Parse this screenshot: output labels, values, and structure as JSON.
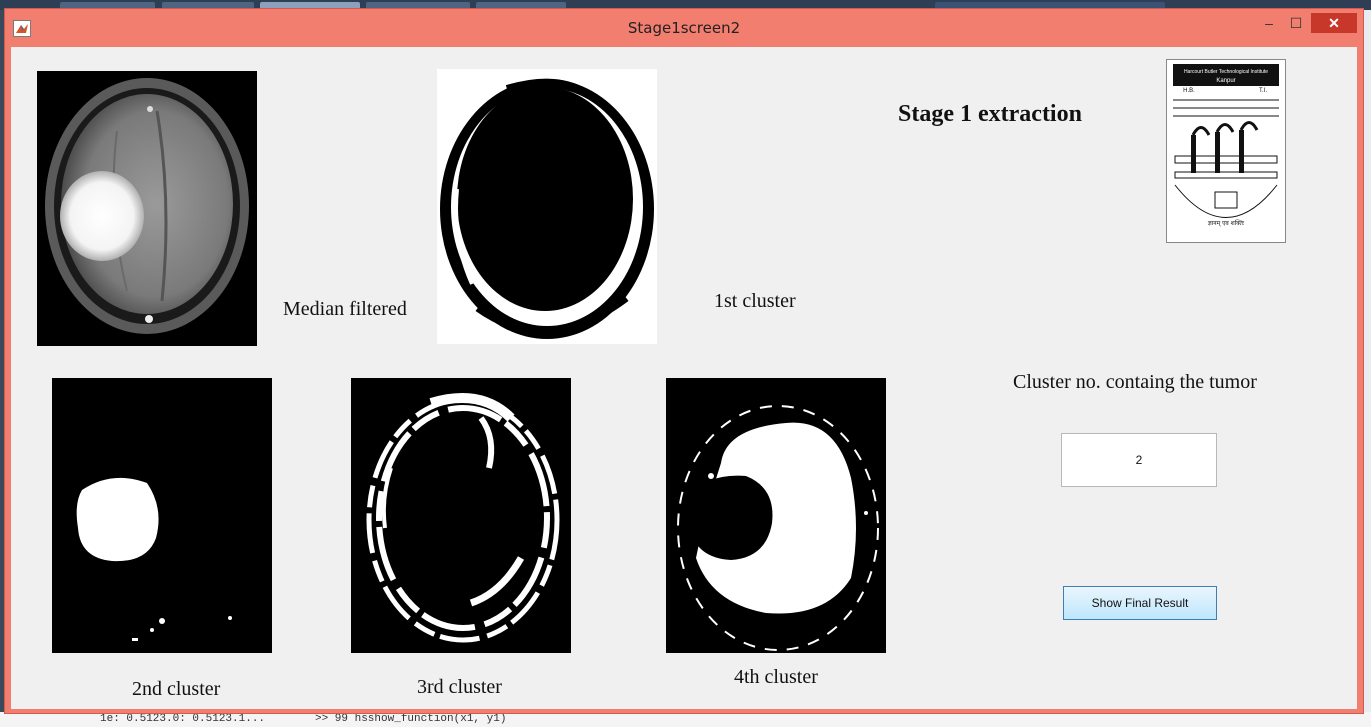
{
  "window": {
    "title": "Stage1screen2",
    "controls": {
      "minimize": "–",
      "maximize": "☐",
      "close": "✕"
    }
  },
  "heading": "Stage 1 extraction",
  "images": {
    "median_filtered": {
      "label": "Median filtered"
    },
    "cluster1": {
      "label": "1st cluster"
    },
    "cluster2": {
      "label": "2nd cluster"
    },
    "cluster3": {
      "label": "3rd cluster"
    },
    "cluster4": {
      "label": "4th cluster"
    }
  },
  "logo": {
    "line1": "Harcourt Butler Technological Institute",
    "line2": "Kanpur",
    "left_mark": "H.B.",
    "right_mark": "T.I.",
    "motto": "ज्ञानम् एव शक्तिः"
  },
  "tumor_cluster": {
    "label": "Cluster no. containg the tumor",
    "value": "2"
  },
  "buttons": {
    "show_final": "Show Final Result"
  },
  "background_text": {
    "bottom_left": "1e: 0.5123.0: 0.5123.1...",
    "bottom_mid": ">> 99 hsshow_function(x1, y1)"
  },
  "colors": {
    "title_bar": "#f27e70",
    "close_button": "#c7382a",
    "client": "#f0f0f0"
  }
}
